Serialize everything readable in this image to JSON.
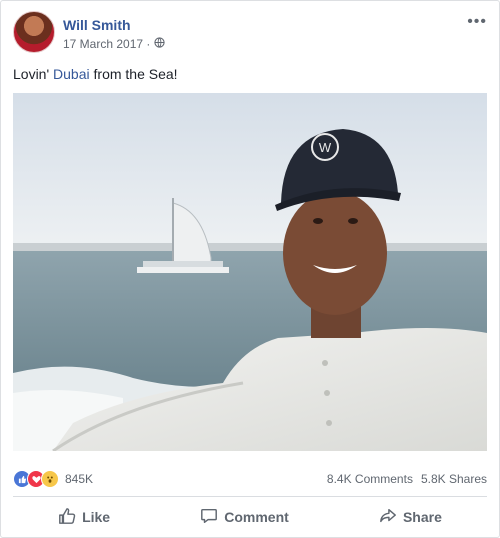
{
  "post": {
    "author": "Will Smith",
    "date": "17 March 2017 ·",
    "caption_pre": "Lovin' ",
    "caption_link": "Dubai",
    "caption_post": " from the Sea!",
    "more_label": "•••"
  },
  "stats": {
    "reactions_count": "845K",
    "comments": "8.4K Comments",
    "shares": "5.8K Shares"
  },
  "actions": {
    "like": "Like",
    "comment": "Comment",
    "share": "Share"
  },
  "photo": {
    "cap_logo": "W"
  },
  "colors": {
    "link": "#365899",
    "meta": "#616770",
    "like": "#4a76d6",
    "love": "#f0364a",
    "wow": "#f7c74a"
  },
  "icons": [
    "globe-icon",
    "more-options-icon",
    "like-reaction-icon",
    "love-reaction-icon",
    "wow-reaction-icon",
    "thumbs-up-icon",
    "comment-icon",
    "share-icon"
  ]
}
